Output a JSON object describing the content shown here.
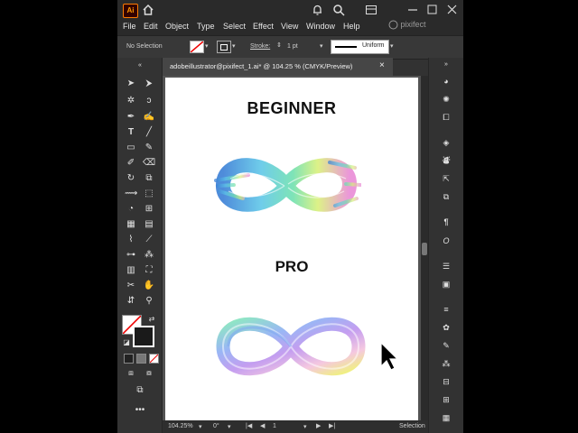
{
  "app": {
    "logo": "Ai"
  },
  "menu": [
    "File",
    "Edit",
    "Object",
    "Type",
    "Select",
    "Effect",
    "View",
    "Window",
    "Help"
  ],
  "watermark": "pixifect",
  "control_bar": {
    "selection": "No Selection",
    "stroke_label": "Stroke:",
    "stroke_weight": "1 pt",
    "profile": "Uniform"
  },
  "document": {
    "tab_title": "adobeillustrator@pixifect_1.ai* @ 104.25 % (CMYK/Preview)",
    "close": "×"
  },
  "artboard": {
    "heading_top": "BEGINNER",
    "heading_bottom": "PRO"
  },
  "status": {
    "zoom": "104.25%",
    "rotation": "0°",
    "artboard_num": "1",
    "mode": "Selection"
  },
  "colors": {
    "accent": "#ff9a00",
    "ui_bg": "#323232",
    "menubar": "#2a2a2a"
  },
  "icons": [
    "home-icon",
    "bell-icon",
    "search-icon",
    "layout-icon",
    "minimize-icon",
    "maximize-icon",
    "close-icon"
  ]
}
